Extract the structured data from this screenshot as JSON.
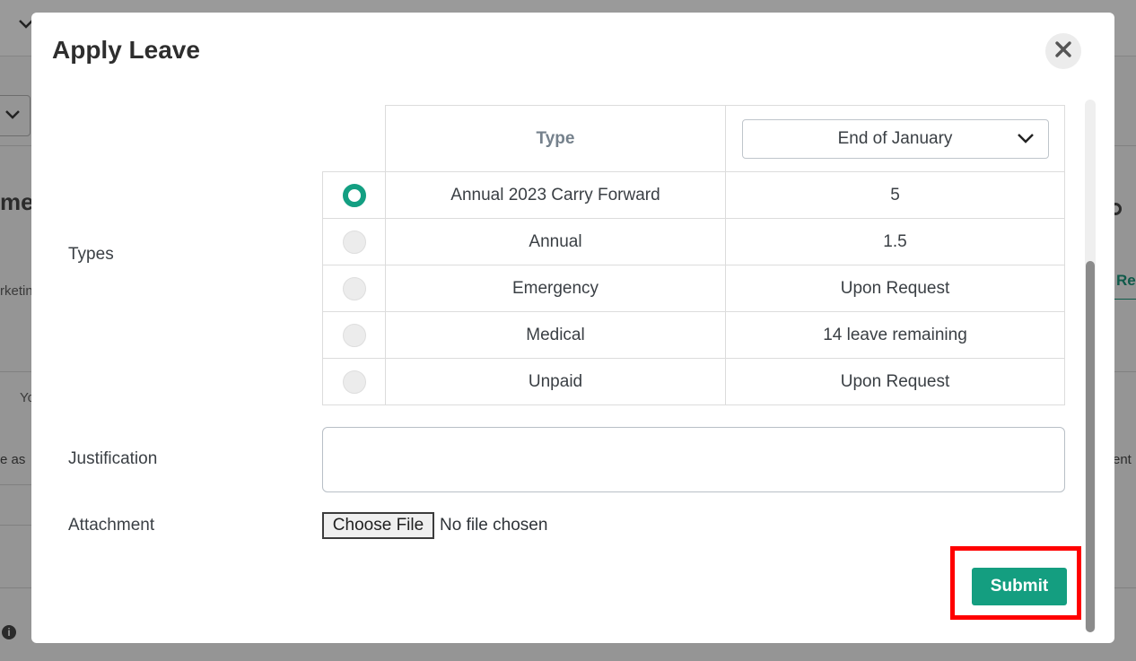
{
  "background": {
    "fragments": [
      "me",
      "rketin",
      "Yo",
      "e as",
      "ent",
      "Req"
    ]
  },
  "modal": {
    "title": "Apply Leave"
  },
  "types_field": {
    "label": "Types",
    "header_type": "Type",
    "period_select_value": "End of January",
    "rows": [
      {
        "type": "Annual 2023 Carry Forward",
        "value": "5",
        "selected": true
      },
      {
        "type": "Annual",
        "value": "1.5",
        "selected": false
      },
      {
        "type": "Emergency",
        "value": "Upon Request",
        "selected": false
      },
      {
        "type": "Medical",
        "value": "14 leave remaining",
        "selected": false
      },
      {
        "type": "Unpaid",
        "value": "Upon Request",
        "selected": false
      }
    ]
  },
  "justification": {
    "label": "Justification",
    "value": ""
  },
  "attachment": {
    "label": "Attachment",
    "button_label": "Choose File",
    "status": "No file chosen"
  },
  "submit": {
    "label": "Submit"
  },
  "colors": {
    "accent": "#149e80",
    "highlight": "#ff0000"
  }
}
